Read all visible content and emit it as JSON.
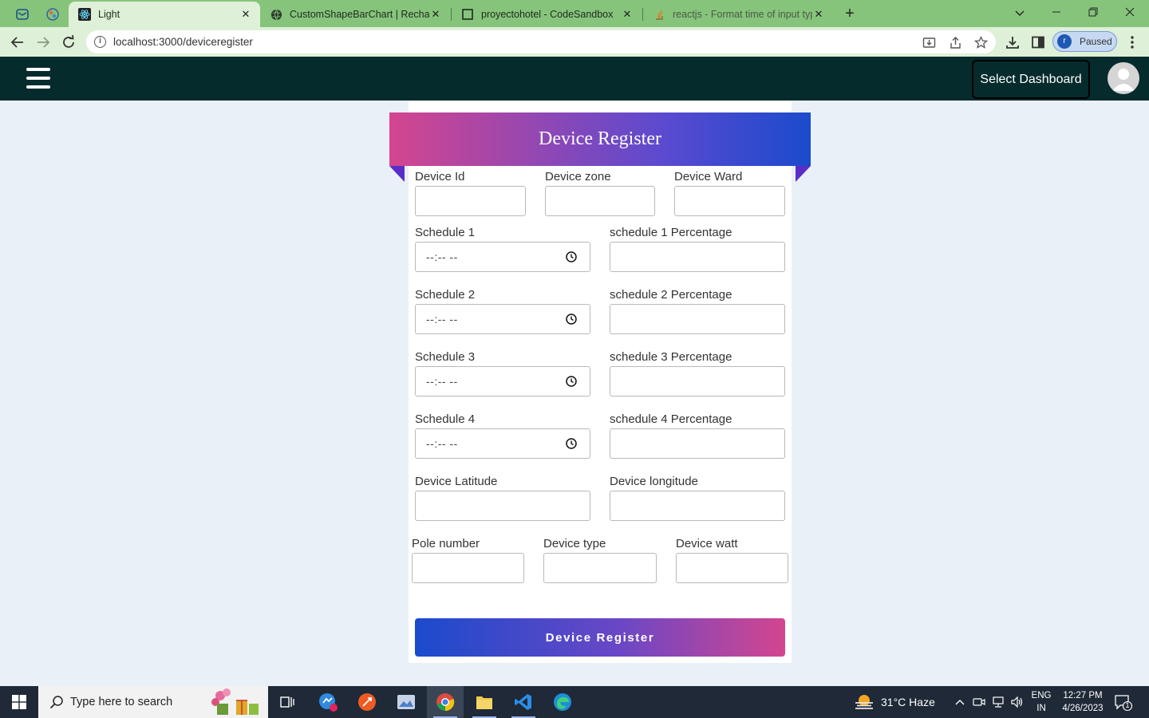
{
  "browser": {
    "tabs": [
      {
        "label": "Light",
        "icon": "react-icon",
        "active": true
      },
      {
        "label": "CustomShapeBarChart | Recharts",
        "icon": "globe-icon"
      },
      {
        "label": "proyectohotel - CodeSandbox",
        "icon": "codesandbox-icon"
      },
      {
        "label": "reactjs - Format time of input typ",
        "icon": "stackoverflow-icon"
      }
    ],
    "url": "localhost:3000/deviceregister",
    "profile_initial": "r",
    "profile_status": "Paused"
  },
  "header": {
    "dashboard_button": "Select Dashboard"
  },
  "form": {
    "title": "Device Register",
    "fields": {
      "device_id": "Device Id",
      "device_zone": "Device zone",
      "device_ward": "Device Ward",
      "schedule_1": "Schedule 1",
      "schedule_1_pct": "schedule 1 Percentage",
      "schedule_2": "Schedule 2",
      "schedule_2_pct": "schedule 2 Percentage",
      "schedule_3": "Schedule 3",
      "schedule_3_pct": "schedule 3 Percentage",
      "schedule_4": "Schedule 4",
      "schedule_4_pct": "schedule 4 Percentage",
      "latitude": "Device Latitude",
      "longitude": "Device longitude",
      "pole_number": "Pole number",
      "device_type": "Device type",
      "device_watt": "Device watt"
    },
    "time_placeholder": "--:-- --",
    "submit_label": "Device Register"
  },
  "taskbar": {
    "search_placeholder": "Type here to search",
    "weather": "31°C  Haze",
    "language": "ENG",
    "region": "IN",
    "time": "12:27 PM",
    "date": "4/26/2023",
    "notification_count": "1"
  },
  "colors": {
    "tab_strip": "#86c47c",
    "toolbar": "#dff0d8",
    "app_header": "#062b2c",
    "page_bg": "#eaf0f8",
    "gradient_pink": "#d4458f",
    "gradient_blue": "#1a4bcc"
  }
}
